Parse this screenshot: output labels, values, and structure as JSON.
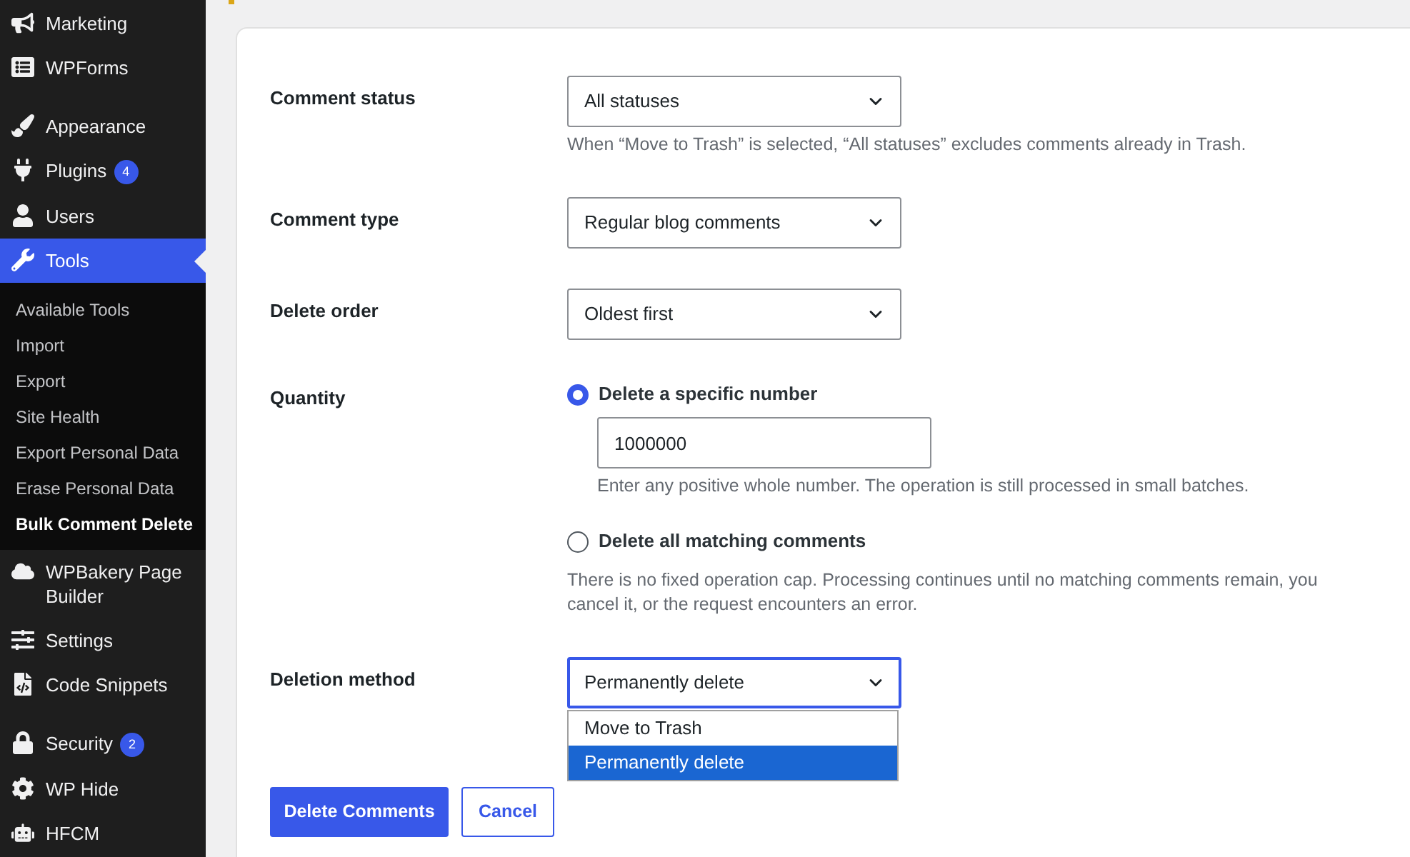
{
  "sidebar": {
    "groups": [
      {
        "items": [
          {
            "label": "Marketing",
            "selected": false
          },
          {
            "label": "WPForms",
            "selected": false
          }
        ]
      },
      {
        "items": [
          {
            "label": "Appearance",
            "selected": false
          },
          {
            "label": "Plugins",
            "selected": false,
            "badge": "4"
          },
          {
            "label": "Users",
            "selected": false
          },
          {
            "label": "Tools",
            "selected": true,
            "children": [
              {
                "label": "Available Tools",
                "selected": false
              },
              {
                "label": "Import",
                "selected": false
              },
              {
                "label": "Export",
                "selected": false
              },
              {
                "label": "Site Health",
                "selected": false
              },
              {
                "label": "Export Personal Data",
                "selected": false
              },
              {
                "label": "Erase Personal Data",
                "selected": false
              },
              {
                "label": "Bulk Comment Delete",
                "selected": true
              }
            ]
          },
          {
            "label": "WPBakery Page Builder",
            "selected": false
          },
          {
            "label": "Settings",
            "selected": false
          },
          {
            "label": "Code Snippets",
            "selected": false
          }
        ]
      },
      {
        "items": [
          {
            "label": "Security",
            "selected": false,
            "badge": "2"
          },
          {
            "label": "WP Hide",
            "selected": false
          },
          {
            "label": "HFCM",
            "selected": false
          }
        ]
      }
    ]
  },
  "form": {
    "fields": [
      {
        "kind": "select",
        "label": "Comment status",
        "value": "All statuses",
        "expanded": false,
        "description": "When “Move to Trash” is selected, “All statuses” excludes comments already in Trash."
      },
      {
        "kind": "select",
        "label": "Comment type",
        "value": "Regular blog comments",
        "expanded": false
      },
      {
        "kind": "select",
        "label": "Delete order",
        "value": "Oldest first",
        "expanded": false
      },
      {
        "kind": "radio_group",
        "label": "Quantity",
        "options": [
          {
            "label": "Delete a specific number",
            "selected": true,
            "input": {
              "value": "1000000"
            },
            "description": "Enter any positive whole number. The operation is still processed in small batches."
          },
          {
            "label": "Delete all matching comments",
            "selected": false,
            "description": "There is no fixed operation cap. Processing continues until no matching comments remain, you cancel it, or the request encounters an error."
          }
        ]
      },
      {
        "kind": "select",
        "label": "Deletion method",
        "value": "Permanently delete",
        "expanded": true,
        "options": [
          {
            "label": "Move to Trash",
            "selected": false
          },
          {
            "label": "Permanently delete",
            "selected": true
          }
        ]
      }
    ]
  },
  "buttons": [
    {
      "label": "Delete Comments",
      "kind": "primary"
    },
    {
      "label": "Cancel",
      "kind": "secondary"
    }
  ]
}
